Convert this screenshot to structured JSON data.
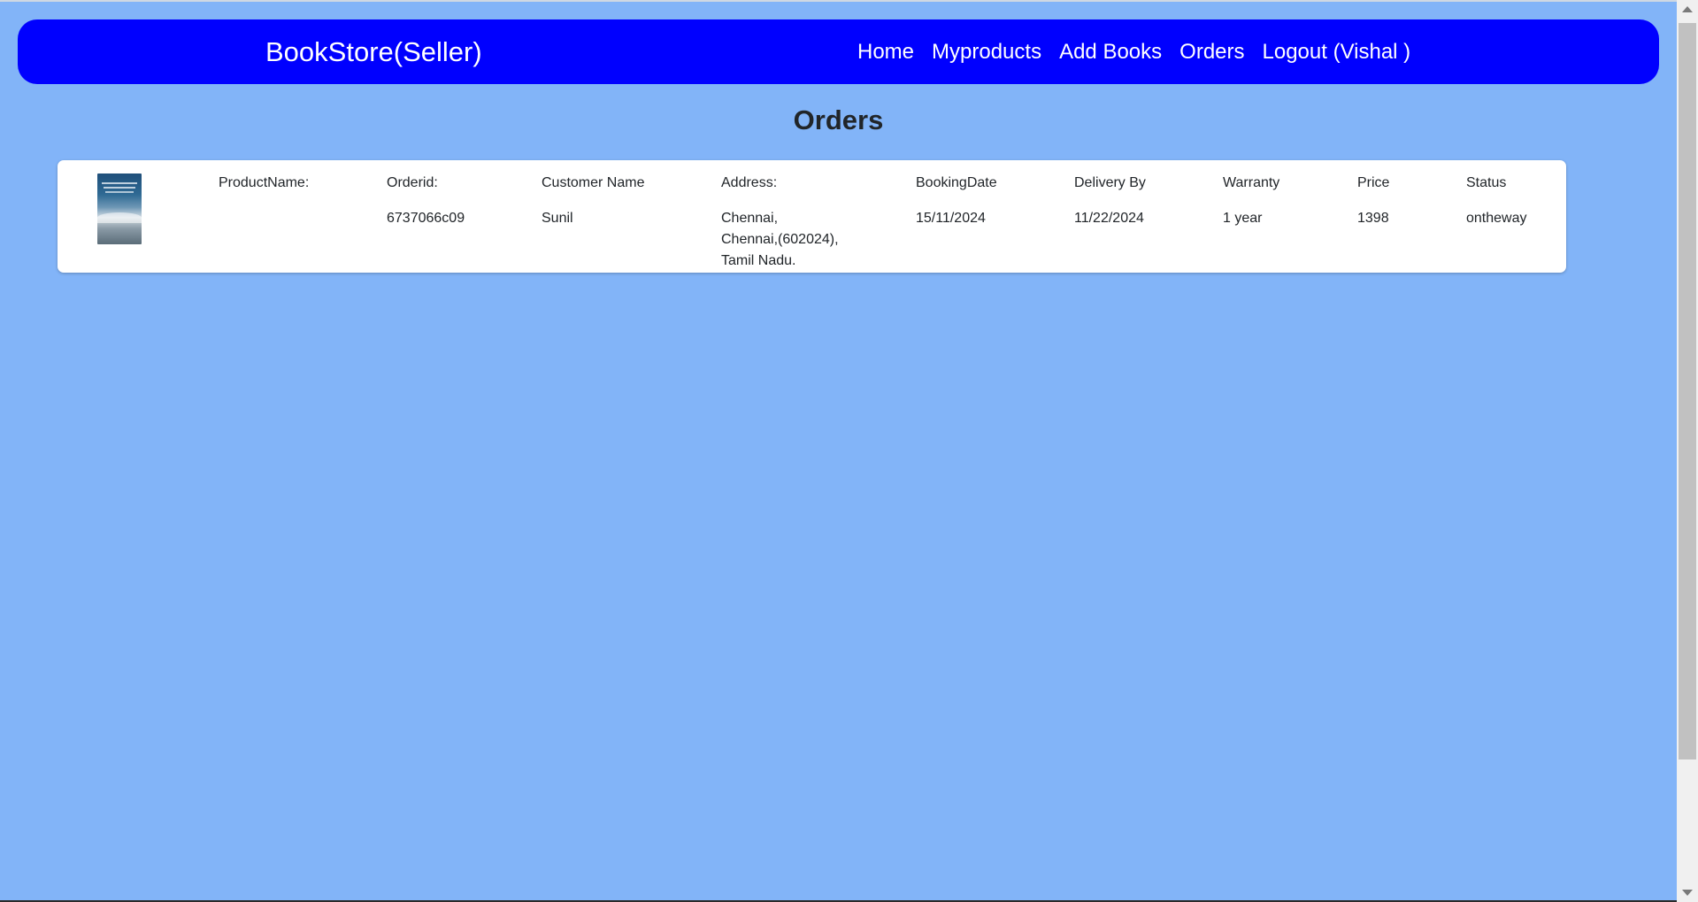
{
  "navbar": {
    "brand": "BookStore(Seller)",
    "links": [
      "Home",
      "Myproducts",
      "Add Books",
      "Orders",
      "Logout (Vishal )"
    ],
    "background": "#0000ff"
  },
  "page": {
    "title": "Orders",
    "background": "#82b4f8"
  },
  "order": {
    "headers": {
      "product_name": "ProductName:",
      "order_id": "Orderid:",
      "customer_name": "Customer Name",
      "address": "Address:",
      "booking_date": "BookingDate",
      "delivery_by": "Delivery By",
      "warranty": "Warranty",
      "price": "Price",
      "status": "Status"
    },
    "values": {
      "order_id": "6737066c09",
      "customer_name": "Sunil",
      "address_lines": [
        "Chennai,",
        "Chennai,(602024),",
        "Tamil Nadu."
      ],
      "booking_date": "15/11/2024",
      "delivery_by": "11/22/2024",
      "warranty": "1 year",
      "price": "1398",
      "status": "ontheway"
    },
    "image_icon": "book-cover-image"
  }
}
